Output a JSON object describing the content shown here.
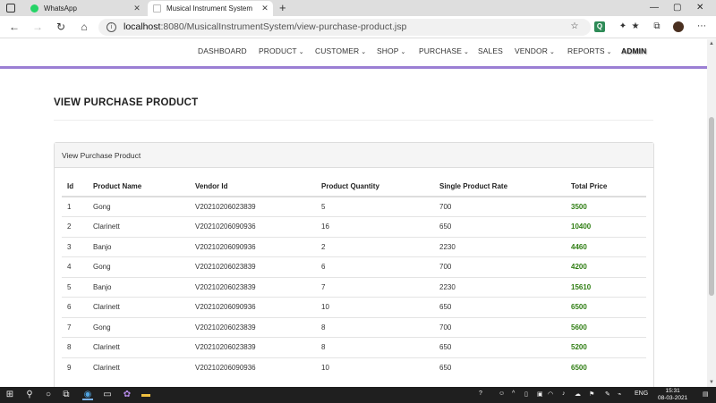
{
  "browser": {
    "tabs": [
      {
        "title": "WhatsApp",
        "active": false,
        "favicon_color": "#25d366"
      },
      {
        "title": "Musical Instrument System",
        "active": true,
        "favicon_color": "#bbbbbb"
      }
    ],
    "url_host": "localhost",
    "url_rest": ":8080/MusicalInstrumentSystem/view-purchase-product.jsp"
  },
  "nav": {
    "items": [
      {
        "label": "DASHBOARD",
        "dropdown": false
      },
      {
        "label": "PRODUCT",
        "dropdown": true
      },
      {
        "label": "CUSTOMER",
        "dropdown": true
      },
      {
        "label": "SHOP",
        "dropdown": true
      },
      {
        "label": "PURCHASE",
        "dropdown": true
      },
      {
        "label": "SALES",
        "dropdown": false
      },
      {
        "label": "VENDOR",
        "dropdown": true
      },
      {
        "label": "REPORTS",
        "dropdown": true
      }
    ],
    "admin_label": "ADMIN",
    "accent_color": "#9b7fd4"
  },
  "page": {
    "heading": "VIEW PURCHASE PRODUCT",
    "panel_title": "View Purchase Product"
  },
  "table": {
    "headers": [
      "Id",
      "Product Name",
      "Vendor Id",
      "Product Quantity",
      "Single Product Rate",
      "Total Price"
    ],
    "rows": [
      [
        "1",
        "Gong",
        "V20210206023839",
        "5",
        "700",
        "3500"
      ],
      [
        "2",
        "Clarinett",
        "V20210206090936",
        "16",
        "650",
        "10400"
      ],
      [
        "3",
        "Banjo",
        "V20210206090936",
        "2",
        "2230",
        "4460"
      ],
      [
        "4",
        "Gong",
        "V20210206023839",
        "6",
        "700",
        "4200"
      ],
      [
        "5",
        "Banjo",
        "V20210206023839",
        "7",
        "2230",
        "15610"
      ],
      [
        "6",
        "Clarinett",
        "V20210206090936",
        "10",
        "650",
        "6500"
      ],
      [
        "7",
        "Gong",
        "V20210206023839",
        "8",
        "700",
        "5600"
      ],
      [
        "8",
        "Clarinett",
        "V20210206023839",
        "8",
        "650",
        "5200"
      ],
      [
        "9",
        "Clarinett",
        "V20210206090936",
        "10",
        "650",
        "6500"
      ]
    ],
    "total_color": "#2e7d12"
  },
  "taskbar": {
    "lang": "ENG",
    "time": "15:31",
    "date": "08-03-2021"
  }
}
